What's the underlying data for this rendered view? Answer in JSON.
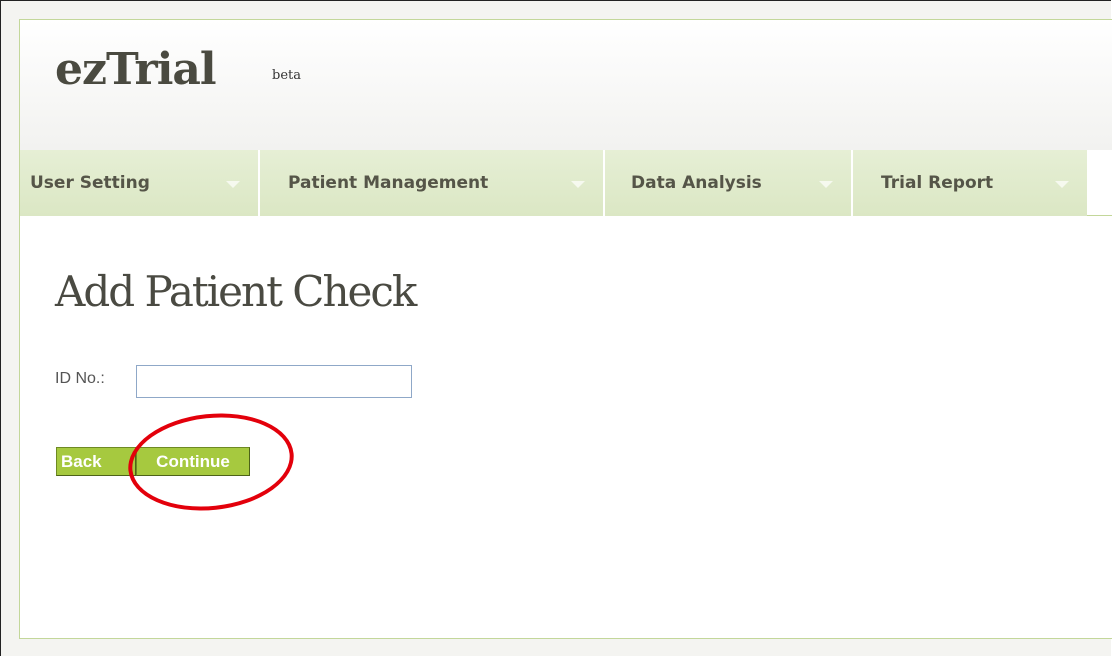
{
  "app": {
    "logo": "ezTrial",
    "logo_badge": "beta"
  },
  "nav": {
    "tabs": [
      {
        "label": "User Setting"
      },
      {
        "label": "Patient Management"
      },
      {
        "label": "Data Analysis"
      },
      {
        "label": "Trial Report"
      }
    ]
  },
  "page": {
    "title": "Add Patient Check"
  },
  "form": {
    "id_label": "ID No.:",
    "id_value": "",
    "id_placeholder": ""
  },
  "actions": {
    "back_label": "Back",
    "continue_label": "Continue"
  },
  "colors": {
    "accent": "#a6c93f",
    "nav_bg": "#dbe7c4",
    "frame_border": "#c3d79a",
    "annotation": "#e3000b"
  }
}
